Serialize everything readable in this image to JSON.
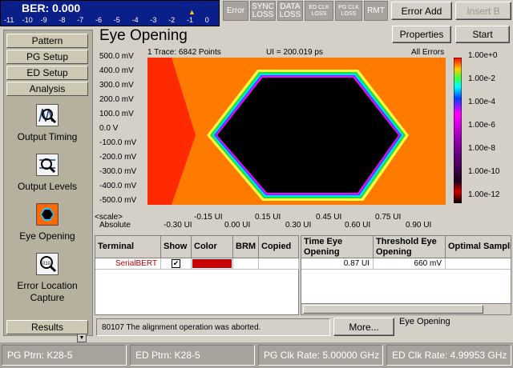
{
  "ber": {
    "value_text": "BER: 0.000",
    "scale_labels": [
      "-11",
      "-10",
      "-9",
      "-8",
      "-7",
      "-6",
      "-5",
      "-4",
      "-3",
      "-2",
      "-1",
      "0"
    ],
    "marker_label": "▲",
    "marker_value": -1
  },
  "status_indicators": [
    {
      "label": "Error"
    },
    {
      "label": "SYNC LOSS"
    },
    {
      "label": "DATA LOSS"
    },
    {
      "label": "ED CLK LOSS"
    },
    {
      "label": "PG CLK LOSS"
    },
    {
      "label": "RMT"
    }
  ],
  "toolbar": {
    "error_add_label": "Error Add",
    "insert_label": "Insert B",
    "properties_label": "Properties",
    "start_label": "Start"
  },
  "nav": {
    "pattern": "Pattern",
    "pg_setup": "PG Setup",
    "ed_setup": "ED Setup",
    "analysis": "Analysis",
    "results": "Results"
  },
  "analysis_items": [
    {
      "label": "Output Timing",
      "icon": "output-timing-icon"
    },
    {
      "label": "Output Levels",
      "icon": "output-levels-icon"
    },
    {
      "label": "Eye Opening",
      "icon": "eye-opening-icon"
    },
    {
      "label": "Error Location Capture",
      "icon": "error-location-icon"
    }
  ],
  "main": {
    "title": "Eye Opening"
  },
  "plot": {
    "trace_info": "1 Trace: 6842 Points",
    "ui_info": "UI = 200.019 ps",
    "mode": "All Errors",
    "y_labels": [
      "500.0 mV",
      "400.0 mV",
      "300.0 mV",
      "200.0 mV",
      "100.0 mV",
      "0.0 V",
      "-100.0 mV",
      "-200.0 mV",
      "-300.0 mV",
      "-400.0 mV",
      "-500.0 mV"
    ],
    "scale_caption": "<scale>",
    "absolute_caption": "Absolute",
    "scale_ticks": [
      "-0.15 UI",
      "0.15 UI",
      "0.45 UI",
      "0.75 UI"
    ],
    "absolute_ticks": [
      "-0.30 UI",
      "0.00 UI",
      "0.30 UI",
      "0.60 UI",
      "0.90 UI"
    ],
    "colorbar_labels": [
      "1.00e+0",
      "1.00e-2",
      "1.00e-4",
      "1.00e-6",
      "1.00e-8",
      "1.00e-10",
      "1.00e-12"
    ],
    "colors": {
      "outer": "#ff2a00",
      "mid": "#ff7a00",
      "inner": "#ffb000",
      "yellow": "#ffff40",
      "green": "#20e040",
      "cyan": "#00e0ff",
      "blue": "#2050ff",
      "magenta": "#ff00ff",
      "eye": "#000000"
    }
  },
  "table_left": {
    "headers": [
      "Terminal",
      "Show",
      "Color",
      "BRM",
      "Copied"
    ],
    "row": {
      "terminal": "SerialBERT",
      "show": "✔",
      "color": "#c80000"
    }
  },
  "table_right": {
    "headers": [
      "Time Eye Opening",
      "Threshold Eye Opening",
      "Optimal Sampling Delay"
    ],
    "row": {
      "time_eye": "0.87 UI",
      "threshold_eye": "660 mV"
    }
  },
  "message": {
    "text": "80107 The alignment operation was aborted.",
    "more_label": "More...",
    "right_status": "Eye Opening"
  },
  "status_bar": {
    "pg_ptrn": "PG Ptrn: K28-5",
    "ed_ptrn": "ED Ptrn: K28-5",
    "pg_clk": "PG Clk Rate: 5.00000 GHz",
    "ed_clk": "ED Clk Rate: 4.99953 GHz"
  }
}
